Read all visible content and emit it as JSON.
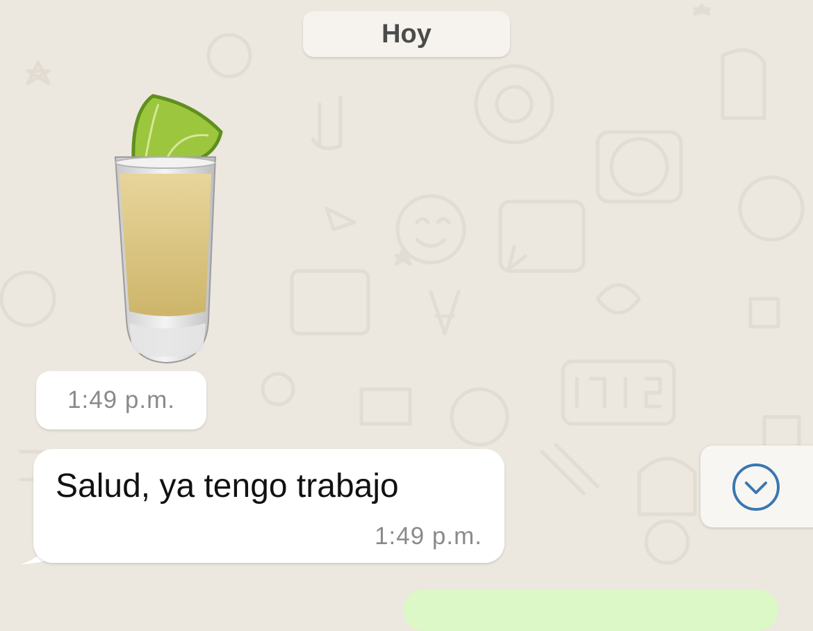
{
  "chat": {
    "date_label": "Hoy",
    "messages": [
      {
        "type": "sticker",
        "sticker_name": "tequila-shot-with-lime",
        "time": "1:49 p.m."
      },
      {
        "type": "text",
        "text": "Salud, ya tengo trabajo",
        "time": "1:49 p.m."
      },
      {
        "type": "outgoing-partial"
      }
    ]
  },
  "controls": {
    "scroll_down_icon": "chevron-down-circle-icon"
  },
  "colors": {
    "background": "#ece7df",
    "incoming_bubble": "#ffffff",
    "outgoing_bubble": "#dcf8c6",
    "accent": "#3a77b1"
  }
}
